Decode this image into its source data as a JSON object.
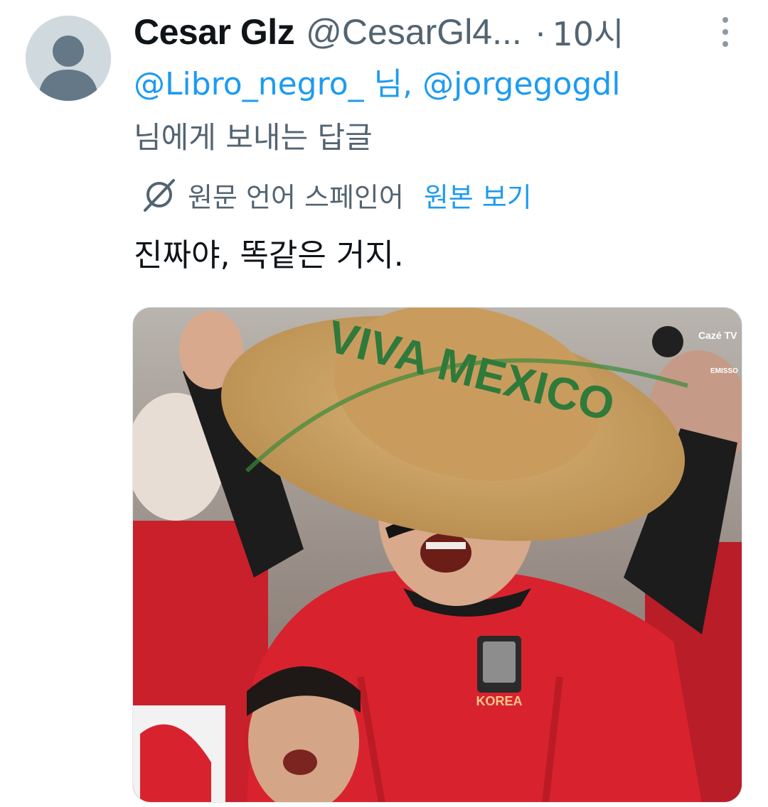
{
  "tweet": {
    "author": {
      "display_name": "Cesar Glz",
      "handle": "@CesarGl4...",
      "separator": "·",
      "time": "10시",
      "avatar_icon": "default-avatar-icon"
    },
    "more_icon": "more-vertical-icon",
    "reply_to": {
      "mention_1": "@Libro_negro_",
      "suffix_1": " 님, ",
      "mention_2": "@jorgegogdl",
      "tail": "님에게 보내는 답글"
    },
    "translation": {
      "icon": "translate-globe-icon",
      "note": "원문 언어 스페인어",
      "show_original": "원본 보기"
    },
    "text": "진짜야, 똑같은 거지.",
    "media": {
      "hat_text": "VIVA MEXICO",
      "jersey_text": "KOREA",
      "watermark": "Cazé TV",
      "watermark_sub": "EMISSO"
    }
  },
  "colors": {
    "link": "#1d9bf0",
    "secondary": "#536471",
    "text": "#0f1419",
    "jersey_red": "#d8232f"
  }
}
